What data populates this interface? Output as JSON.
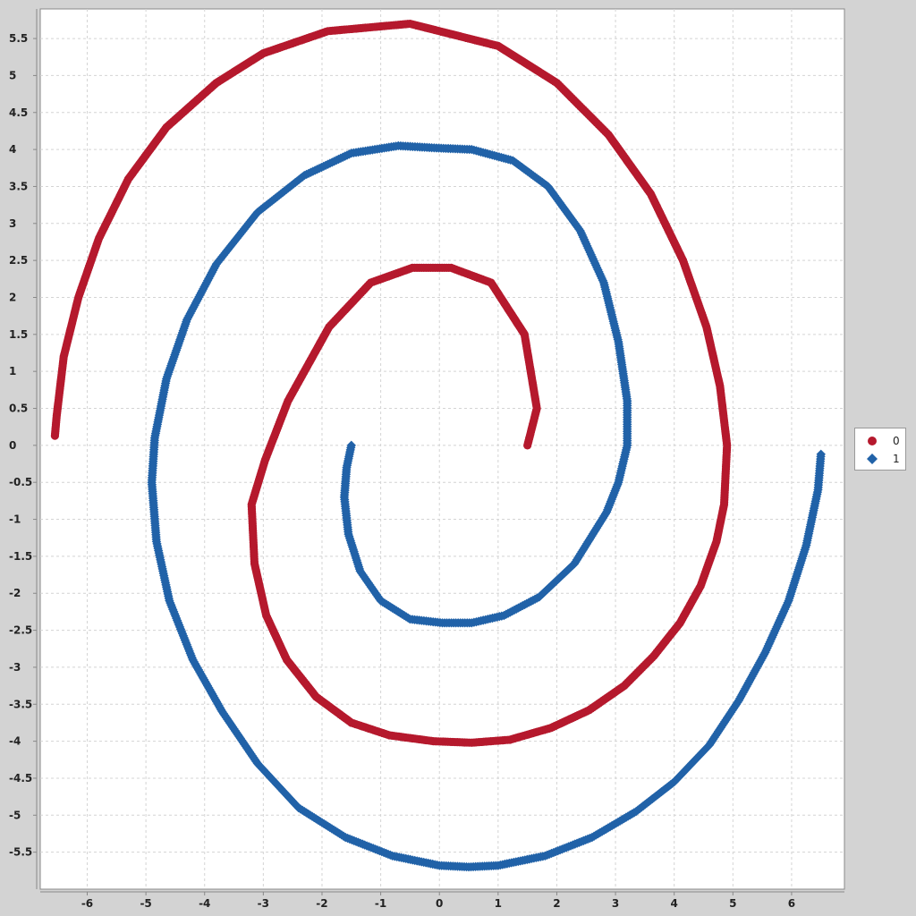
{
  "chart_data": {
    "type": "scatter",
    "title": "",
    "xlabel": "",
    "ylabel": "",
    "xlim": [
      -6.8,
      6.9
    ],
    "ylim": [
      -6.0,
      5.9
    ],
    "grid": true,
    "legend_position": "right",
    "x_ticks": [
      -6,
      -5,
      -4,
      -3,
      -2,
      -1,
      0,
      1,
      2,
      3,
      4,
      5,
      6
    ],
    "y_ticks": [
      -5.5,
      -5,
      -4.5,
      -4,
      -3.5,
      -3,
      -2.5,
      -2,
      -1.5,
      -1,
      -0.5,
      0,
      0.5,
      1,
      1.5,
      2,
      2.5,
      3,
      3.5,
      4,
      4.5,
      5,
      5.5
    ],
    "series": [
      {
        "name": "0",
        "marker": "circle",
        "color": "#b5192d",
        "x": [
          1.5,
          1.66,
          1.45,
          0.88,
          0.2,
          -0.46,
          -1.17,
          -1.88,
          -2.58,
          -2.97,
          -3.2,
          -3.15,
          -2.95,
          -2.6,
          -2.1,
          -1.5,
          -0.85,
          -0.1,
          0.55,
          1.2,
          1.9,
          2.55,
          3.15,
          3.65,
          4.1,
          4.45,
          4.72,
          4.85,
          4.9,
          4.78,
          4.55,
          4.15,
          3.6,
          2.88,
          2.0,
          1.0,
          -0.5,
          -1.9,
          -3.0,
          -3.8,
          -4.65,
          -5.3,
          -5.8,
          -6.15,
          -6.4,
          -6.52,
          -6.55
        ],
        "y": [
          0.0,
          0.5,
          1.5,
          2.2,
          2.4,
          2.4,
          2.2,
          1.6,
          0.6,
          -0.2,
          -0.8,
          -1.6,
          -2.3,
          -2.9,
          -3.4,
          -3.75,
          -3.92,
          -4.0,
          -4.02,
          -3.98,
          -3.82,
          -3.58,
          -3.25,
          -2.85,
          -2.4,
          -1.9,
          -1.3,
          -0.8,
          0.0,
          0.8,
          1.6,
          2.5,
          3.4,
          4.2,
          4.9,
          5.4,
          5.7,
          5.6,
          5.3,
          4.9,
          4.3,
          3.6,
          2.8,
          2.0,
          1.2,
          0.4,
          0.13
        ]
      },
      {
        "name": "1",
        "marker": "diamond",
        "color": "#2162a8",
        "x": [
          -1.5,
          -1.58,
          -1.62,
          -1.55,
          -1.35,
          -1.0,
          -0.5,
          0.05,
          0.55,
          1.1,
          1.7,
          2.3,
          2.85,
          3.05,
          3.2,
          3.2,
          3.05,
          2.8,
          2.4,
          1.85,
          1.25,
          0.55,
          -0.05,
          -0.7,
          -1.5,
          -2.3,
          -3.1,
          -3.8,
          -4.3,
          -4.65,
          -4.85,
          -4.9,
          -4.82,
          -4.6,
          -4.2,
          -3.7,
          -3.1,
          -2.4,
          -1.6,
          -0.8,
          0.0,
          0.5,
          1.0,
          1.8,
          2.6,
          3.35,
          4.0,
          4.6,
          5.1,
          5.55,
          5.95,
          6.25,
          6.45,
          6.5
        ],
        "y": [
          0.0,
          -0.3,
          -0.7,
          -1.2,
          -1.7,
          -2.1,
          -2.35,
          -2.4,
          -2.4,
          -2.3,
          -2.05,
          -1.6,
          -0.9,
          -0.5,
          0.0,
          0.6,
          1.4,
          2.2,
          2.9,
          3.5,
          3.85,
          4.0,
          4.02,
          4.05,
          3.95,
          3.65,
          3.15,
          2.45,
          1.7,
          0.9,
          0.1,
          -0.5,
          -1.3,
          -2.1,
          -2.9,
          -3.6,
          -4.3,
          -4.9,
          -5.3,
          -5.55,
          -5.68,
          -5.7,
          -5.68,
          -5.55,
          -5.3,
          -4.95,
          -4.55,
          -4.05,
          -3.45,
          -2.8,
          -2.1,
          -1.35,
          -0.6,
          -0.12
        ]
      }
    ]
  }
}
